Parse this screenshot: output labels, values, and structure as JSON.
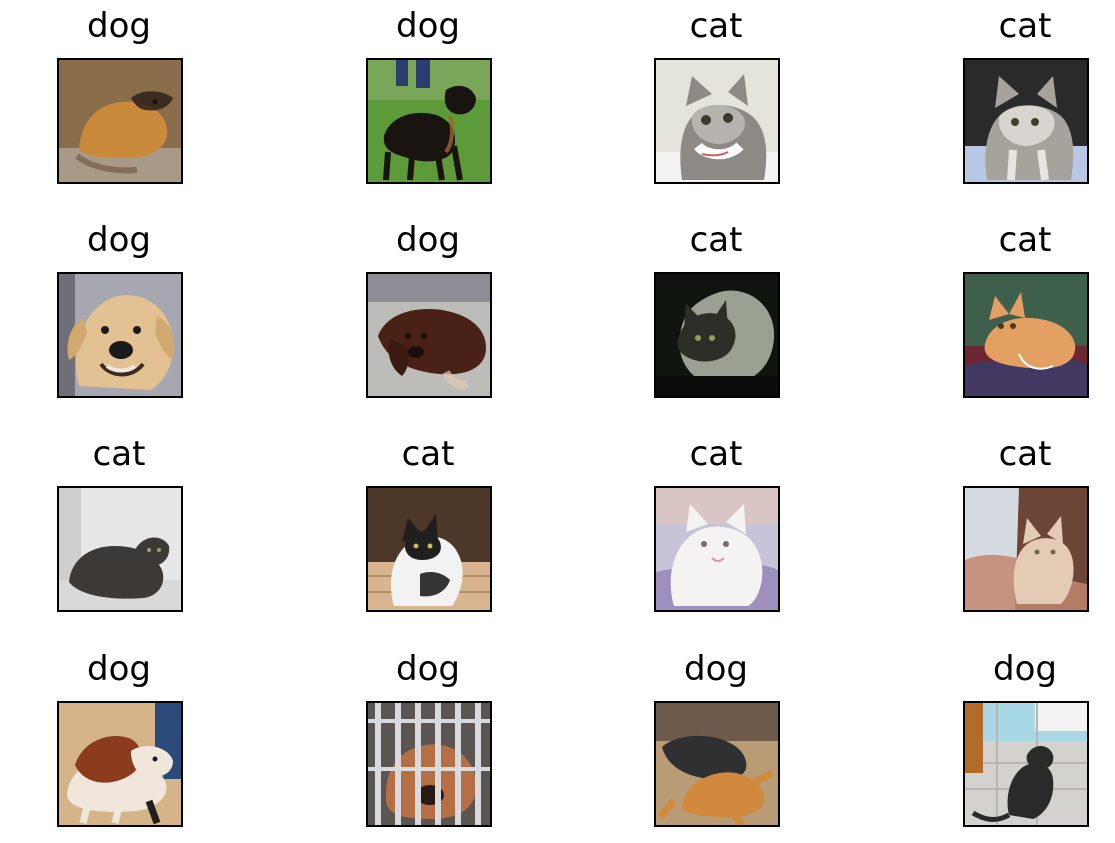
{
  "grid": {
    "rows": 4,
    "cols": 4,
    "items": [
      {
        "label": "dog",
        "image": "dog-photo",
        "bg": "#8a6e4c",
        "subject": "#c98a3c"
      },
      {
        "label": "dog",
        "image": "dog-photo",
        "bg": "#5d9a3a",
        "subject": "#1a1410"
      },
      {
        "label": "cat",
        "image": "cat-photo",
        "bg": "#e4e4dc",
        "subject": "#8d8a86"
      },
      {
        "label": "cat",
        "image": "cat-photo",
        "bg": "#2b2a2a",
        "subject": "#a7a29c"
      },
      {
        "label": "dog",
        "image": "dog-photo",
        "bg": "#a6a7b0",
        "subject": "#e3c193"
      },
      {
        "label": "dog",
        "image": "dog-photo",
        "bg": "#bcbcb9",
        "subject": "#4a2116"
      },
      {
        "label": "cat",
        "image": "cat-photo",
        "bg": "#0f140e",
        "subject": "#c9d0c0"
      },
      {
        "label": "cat",
        "image": "cat-photo",
        "bg": "#6e2732",
        "subject": "#e3a062"
      },
      {
        "label": "cat",
        "image": "cat-photo",
        "bg": "#e7e7e7",
        "subject": "#3c3937"
      },
      {
        "label": "cat",
        "image": "cat-photo",
        "bg": "#4d3728",
        "subject": "#f2f2f2"
      },
      {
        "label": "cat",
        "image": "cat-photo",
        "bg": "#c7c3d8",
        "subject": "#f5f3f2"
      },
      {
        "label": "cat",
        "image": "cat-photo",
        "bg": "#6c4536",
        "subject": "#e3cbb5"
      },
      {
        "label": "dog",
        "image": "dog-photo",
        "bg": "#d6b48a",
        "subject": "#f0e6dc"
      },
      {
        "label": "dog",
        "image": "dog-photo",
        "bg": "#5a5553",
        "subject": "#b46f44"
      },
      {
        "label": "dog",
        "image": "dog-photo",
        "bg": "#b99b75",
        "subject": "#d1893d"
      },
      {
        "label": "dog",
        "image": "dog-photo",
        "bg": "#d4d2cf",
        "subject": "#2a2a2a"
      }
    ]
  }
}
